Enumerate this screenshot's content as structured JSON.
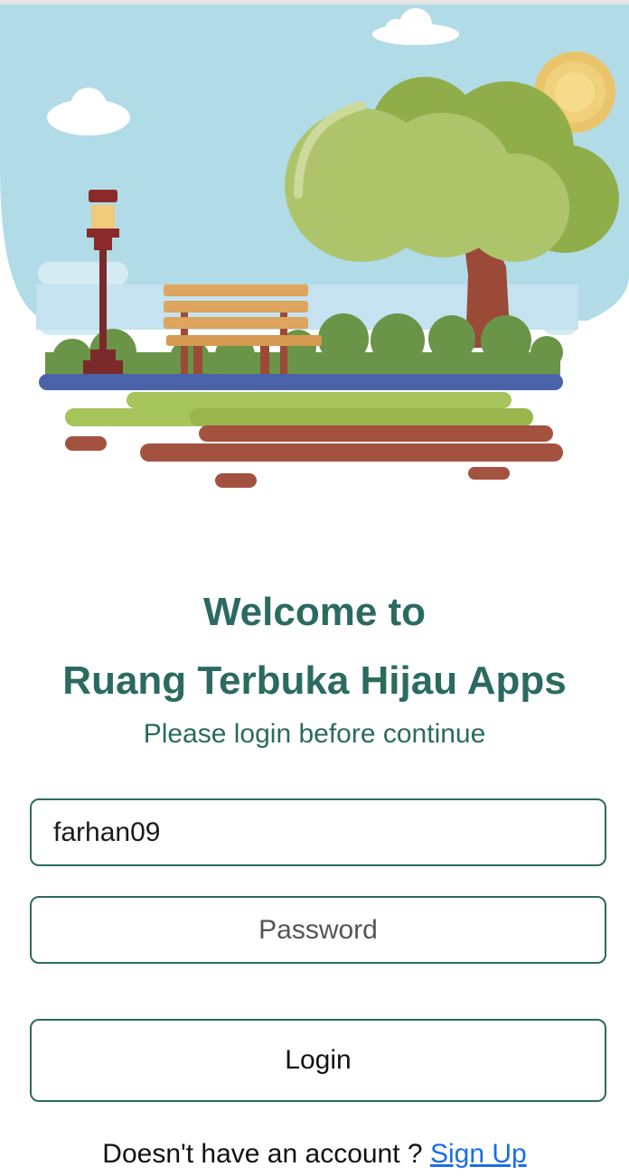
{
  "hero": {
    "illustration": "park-illustration",
    "colors": {
      "sky": "#b2dbe8",
      "tree_canopy": "#adc46b",
      "grass": "#9bbb4f",
      "water": "#4a63a8",
      "soil": "#a3523f",
      "bench": "#dda55e",
      "sun": "#f5d779"
    }
  },
  "welcome": {
    "line1": "Welcome to",
    "line2": "Ruang Terbuka Hijau Apps",
    "subtitle": "Please login before continue"
  },
  "form": {
    "username_value": "farhan09",
    "password_placeholder": "Password",
    "login_label": "Login"
  },
  "footer": {
    "prompt": "Doesn't have an account ?",
    "signup_label": "Sign Up"
  },
  "theme": {
    "accent": "#2b6a60",
    "link": "#1a6ee8"
  }
}
